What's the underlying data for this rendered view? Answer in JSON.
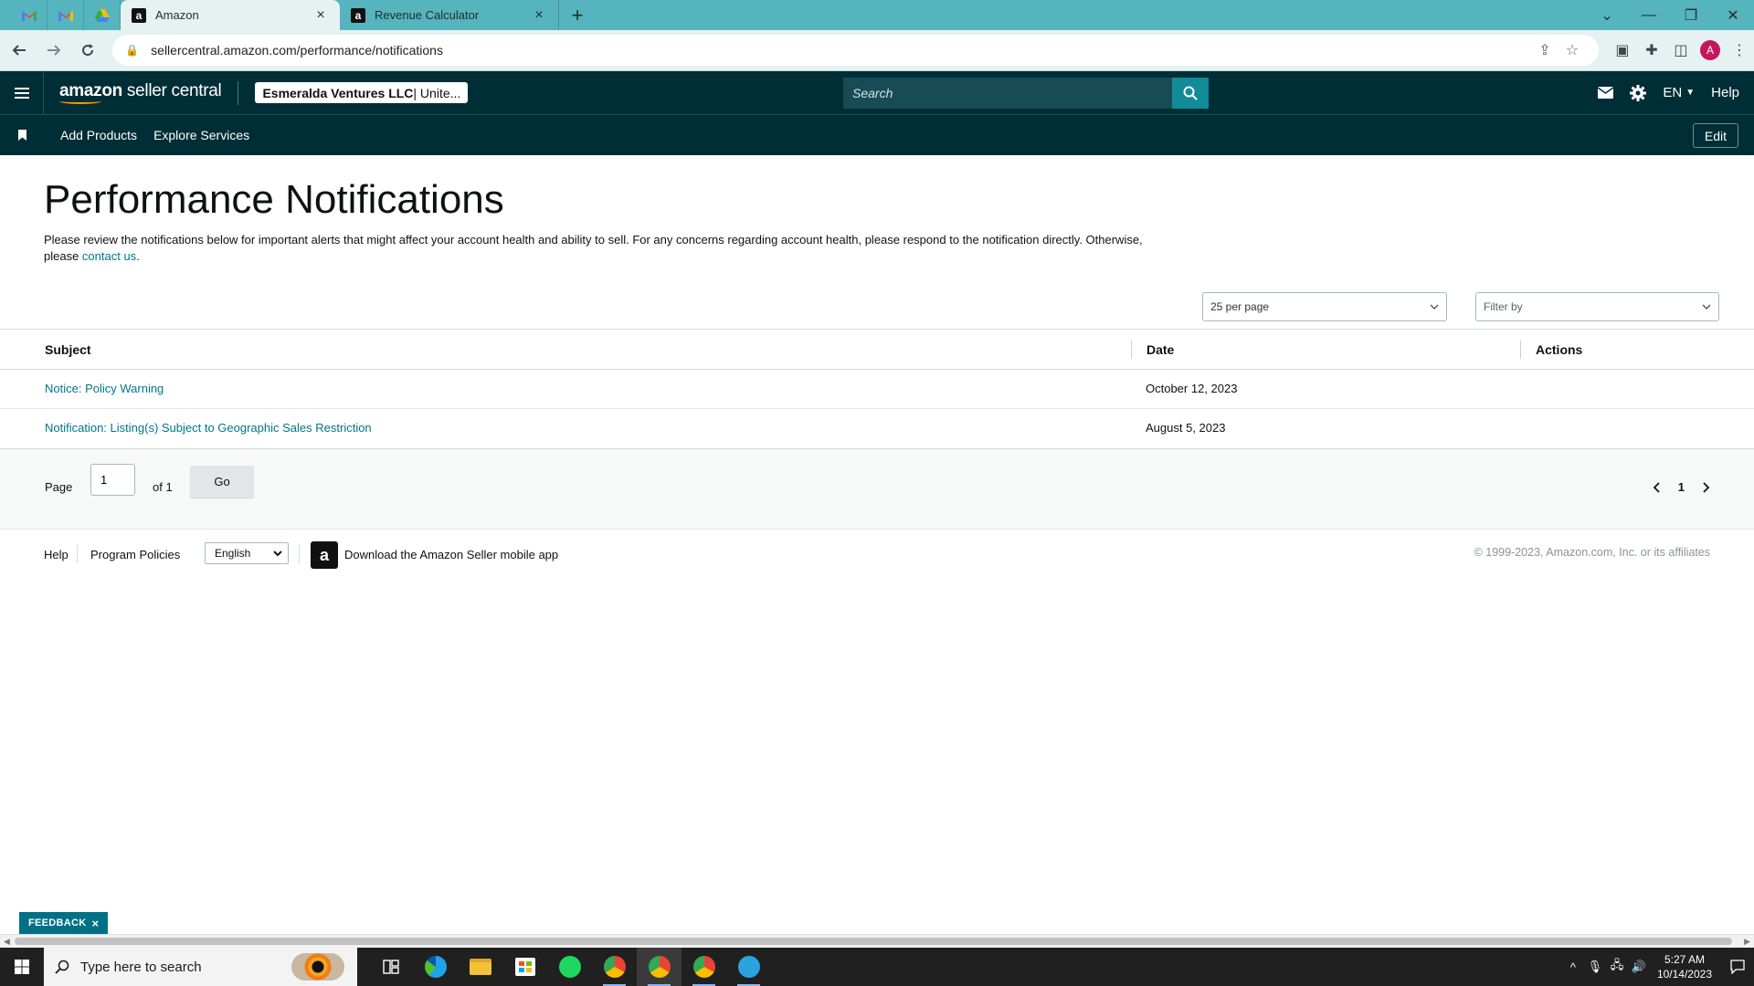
{
  "browser": {
    "tabs": [
      {
        "title": "Amazon",
        "active": true
      },
      {
        "title": "Revenue Calculator",
        "active": false
      }
    ],
    "tab_close_glyph": "×",
    "new_tab_glyph": "+",
    "url": "sellercentral.amazon.com/performance/notifications"
  },
  "header": {
    "logo_prefix": "amazon",
    "logo_suffix": " seller central",
    "account_name": "Esmeralda Ventures LLC",
    "account_region": " | Unite...",
    "search_placeholder": "Search",
    "language": "EN",
    "help_label": "Help"
  },
  "nav": {
    "items": [
      "Add Products",
      "Explore Services"
    ],
    "edit_label": "Edit"
  },
  "page": {
    "title": "Performance Notifications",
    "description": "Please review the notifications below for important alerts that might affect your account health and ability to sell. For any concerns regarding account health, please respond to the notification directly. Otherwise, please ",
    "contact_link": "contact us",
    "description_end": ".",
    "per_page": "25 per page",
    "filter_placeholder": "Filter by"
  },
  "table": {
    "headers": {
      "subject": "Subject",
      "date": "Date",
      "actions": "Actions"
    },
    "rows": [
      {
        "subject": "Notice: Policy Warning",
        "date": "October 12, 2023"
      },
      {
        "subject": "Notification: Listing(s) Subject to Geographic Sales Restriction",
        "date": "August 5, 2023"
      }
    ]
  },
  "pagination": {
    "page_label": "Page",
    "current_page": "1",
    "of_label": "of 1",
    "go_label": "Go",
    "page_number": "1"
  },
  "footer": {
    "help": "Help",
    "policies": "Program Policies",
    "language": "English",
    "app_text": "Download the Amazon Seller mobile app",
    "copyright": "© 1999-2023, Amazon.com, Inc. or its affiliates"
  },
  "feedback": {
    "label": "FEEDBACK",
    "close": "×"
  },
  "taskbar": {
    "search_placeholder": "Type here to search",
    "time": "5:27 AM",
    "date": "10/14/2023"
  },
  "colors": {
    "tab_strip": "#55b4bd",
    "header_bg": "#002e36",
    "link": "#00768a",
    "search_button": "#128b99"
  }
}
